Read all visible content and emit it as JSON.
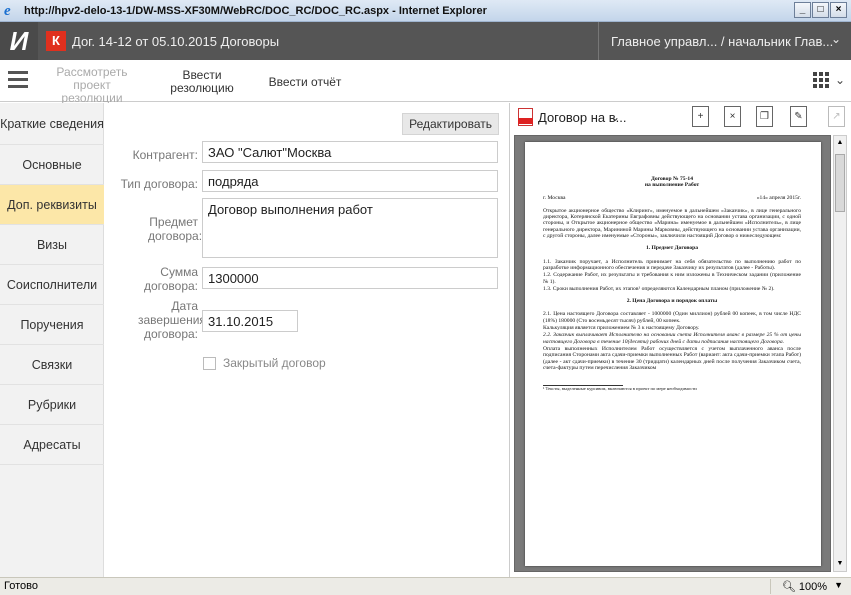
{
  "browser": {
    "title": "http://hpv2-delo-13-1/DW-MSS-XF30M/WebRC/DOC_RC/DOC_RC.aspx - Internet Explorer",
    "minimize": "_",
    "maximize": "□",
    "close": "×"
  },
  "app": {
    "logo_letter": "И",
    "badge": "К",
    "doc_title": "Дог. 14-12 от 05.10.2015 Договоры",
    "user": "Главное управл... / начальник Глав..."
  },
  "toolbar": {
    "review_project": "Рассмотреть проект резолюции",
    "enter_resolution": "Ввести резолюцию",
    "enter_report": "Ввести отчёт"
  },
  "sidebar": {
    "items": [
      {
        "label": "Краткие сведения"
      },
      {
        "label": "Основные"
      },
      {
        "label": "Доп. реквизиты"
      },
      {
        "label": "Визы"
      },
      {
        "label": "Соисполнители"
      },
      {
        "label": "Поручения"
      },
      {
        "label": "Связки"
      },
      {
        "label": "Рубрики"
      },
      {
        "label": "Адресаты"
      }
    ]
  },
  "form": {
    "edit_button": "Редактировать",
    "contractor_label": "Контрагент:",
    "contractor_value": "ЗАО \"Салют\"Москва",
    "contract_type_label": "Тип договора:",
    "contract_type_value": "подряда",
    "subject_label": "Предмет договора:",
    "subject_value": "Договор выполнения работ",
    "amount_label": "Сумма договора:",
    "amount_value": "1300000",
    "end_date_label": "Дата завершения договора:",
    "end_date_value": "31.10.2015",
    "closed_label": "Закрытый договор"
  },
  "viewer": {
    "doc_name": "Договор на в...",
    "page": {
      "title1": "Договор № 75-14",
      "title2": "на выполнение Работ",
      "city": "г. Москва",
      "date": "«14» апреля 2015г.",
      "intro": "Открытое акционерное общество «Клиринг», именуемое в дальнейшем «Заказчик», в лице генерального директора, Котерянской Екатерины Евграфовны действующего на основании устава организации, с одной стороны, и Открытое акционерное общество «Марина» именуемое в дальнейшем «Исполнитель», в лице генерального директора, Марининой Марины Марковны, действующего на основании устава организации, с другой стороны, далее именуемые «Стороны», заключили настоящий Договор о нижеследующем:",
      "sec1": "1. Предмет Договора",
      "p11": "1.1. Заказчик поручает, а Исполнитель принимает на себя обязательство по выполнению работ по разработке информационного обеспечения и передаче Заказчику их результатов (далее - Работы).",
      "p12": "1.2. Содержание Работ, их результаты и требования к ним изложены в Техническом задании (приложение № 1).",
      "p13": "1.3. Сроки выполнения Работ, их этапов¹ определяются Календарным планом (приложение № 2).",
      "sec2": "2. Цена Договора и порядок оплаты",
      "p21": "2.1. Цена настоящего Договора составляет - 1000000 (Один миллион) рублей 00 копеек, в том числе НДС (18%) 180000 (Сто восемьдесят тысяч) рублей, 00 копеек.",
      "p21b": "Калькуляция является приложением № 3 к настоящему Договору.",
      "p22": "2.2. Заказчик выплачивает Исполнителю на основании счета Исполнителя аванс в размере 25 % от цены настоящего Договора в течение 10(десяти) рабочих дней с даты подписания настоящего Договора.",
      "p23": "Оплата выполненных Исполнителем Работ осуществляется с учетом выплаченного аванса после подписания Сторонами акта сдачи-приемки выполненных Работ (вариант: акта сдачи-приемки этапа Работ) (далее - акт сдачи-приемки) в течение 30 (тридцати) календарных дней после получения Заказчиком счета, счета-фактуры путем перечисления Заказчиком",
      "footnote": "¹ Тексты, выделенные курсивом, включаются в проект по мере необходимости"
    }
  },
  "status": {
    "text": "Готово",
    "zoom": "100%"
  }
}
